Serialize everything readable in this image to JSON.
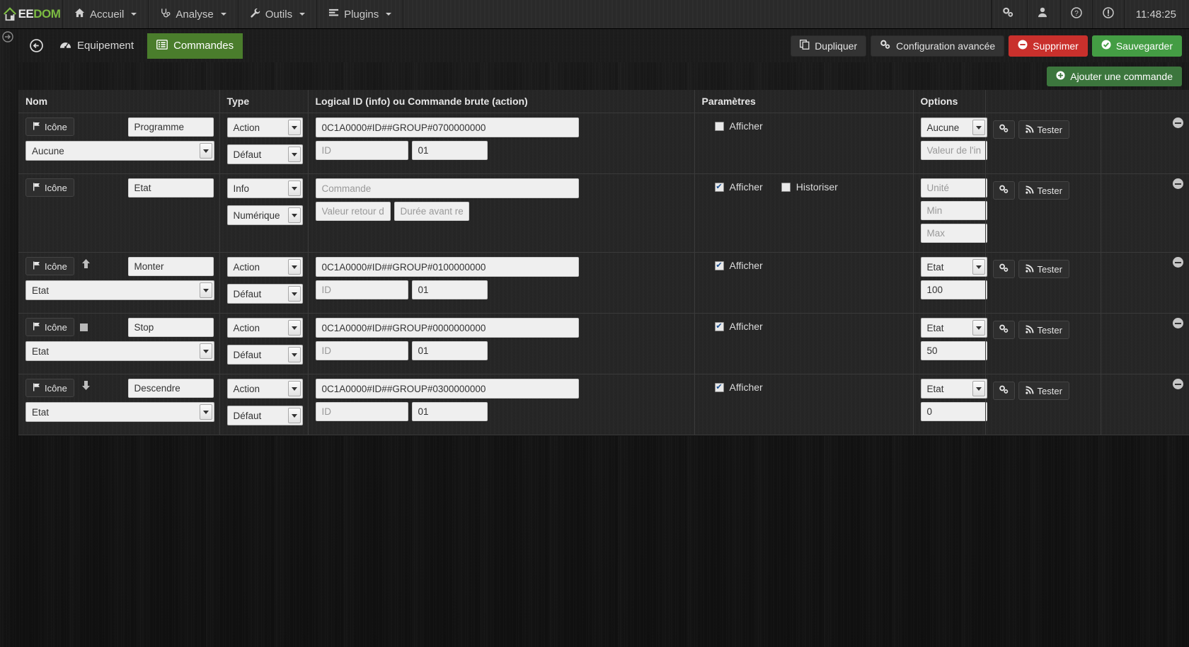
{
  "navbar": {
    "brand": {
      "ee": "EE",
      "dom": "DOM"
    },
    "menus": [
      {
        "label": "Accueil",
        "icon": "home-icon"
      },
      {
        "label": "Analyse",
        "icon": "stethoscope-icon"
      },
      {
        "label": "Outils",
        "icon": "wrench-icon"
      },
      {
        "label": "Plugins",
        "icon": "list-icon"
      }
    ],
    "right_icons": [
      {
        "name": "gears-icon",
        "caret": true
      },
      {
        "name": "user-icon",
        "caret": true
      },
      {
        "name": "help-icon",
        "caret": false
      },
      {
        "name": "warning-icon",
        "caret": false
      }
    ],
    "clock": "11:48:25"
  },
  "toolbar": {
    "back_icon": "arrow-left-circle-icon",
    "tabs": [
      {
        "label": "Equipement",
        "icon": "dashboard-icon",
        "active": false
      },
      {
        "label": "Commandes",
        "icon": "list-alt-icon",
        "active": true
      }
    ],
    "buttons": [
      {
        "label": "Dupliquer",
        "icon": "copy-icon",
        "style": "dark"
      },
      {
        "label": "Configuration avancée",
        "icon": "gears-icon",
        "style": "dark"
      },
      {
        "label": "Supprimer",
        "icon": "minus-circle-icon",
        "style": "danger"
      },
      {
        "label": "Sauvegarder",
        "icon": "check-circle-icon",
        "style": "success"
      }
    ],
    "add_command": {
      "label": "Ajouter une commande",
      "icon": "plus-circle-icon"
    }
  },
  "table": {
    "headers": {
      "nom": "Nom",
      "type": "Type",
      "logical": "Logical ID (info) ou Commande brute (action)",
      "params": "Paramètres",
      "options": "Options",
      "actions": "",
      "delete": ""
    },
    "labels": {
      "icone": "Icône",
      "afficher": "Afficher",
      "historiser": "Historiser",
      "tester": "Tester"
    },
    "rows": [
      {
        "indicator": "none",
        "name": "Programme",
        "subselect": "Aucune",
        "type": "Action",
        "subtype": "Défaut",
        "logical": "0C1A0000#ID##GROUP#0700000000",
        "id_placeholder": "ID",
        "id_value": "",
        "sub_value": "01",
        "afficher": false,
        "show_historiser": false,
        "historiser": false,
        "opt_select": "Aucune",
        "opt_fields": [
          {
            "placeholder": "Valeur de l'info",
            "value": ""
          }
        ]
      },
      {
        "indicator": "none",
        "name": "Etat",
        "subselect": null,
        "type": "Info",
        "subtype": "Numérique",
        "logical": "",
        "logical_placeholder": "Commande",
        "info_fields": [
          {
            "placeholder": "Valeur retour d'état",
            "value": ""
          },
          {
            "placeholder": "Durée avant retour",
            "value": ""
          }
        ],
        "afficher": true,
        "show_historiser": true,
        "historiser": false,
        "opt_select": null,
        "opt_fields": [
          {
            "placeholder": "Unité",
            "value": ""
          },
          {
            "placeholder": "Min",
            "value": ""
          },
          {
            "placeholder": "Max",
            "value": ""
          }
        ]
      },
      {
        "indicator": "arrow-up",
        "name": "Monter",
        "subselect": "Etat",
        "type": "Action",
        "subtype": "Défaut",
        "logical": "0C1A0000#ID##GROUP#0100000000",
        "id_placeholder": "ID",
        "id_value": "",
        "sub_value": "01",
        "afficher": true,
        "show_historiser": false,
        "historiser": false,
        "opt_select": "Etat",
        "opt_fields": [
          {
            "placeholder": "",
            "value": "100"
          }
        ]
      },
      {
        "indicator": "square",
        "name": "Stop",
        "subselect": "Etat",
        "type": "Action",
        "subtype": "Défaut",
        "logical": "0C1A0000#ID##GROUP#0000000000",
        "id_placeholder": "ID",
        "id_value": "",
        "sub_value": "01",
        "afficher": true,
        "show_historiser": false,
        "historiser": false,
        "opt_select": "Etat",
        "opt_fields": [
          {
            "placeholder": "",
            "value": "50"
          }
        ]
      },
      {
        "indicator": "arrow-down",
        "name": "Descendre",
        "subselect": "Etat",
        "type": "Action",
        "subtype": "Défaut",
        "logical": "0C1A0000#ID##GROUP#0300000000",
        "id_placeholder": "ID",
        "id_value": "",
        "sub_value": "01",
        "afficher": true,
        "show_historiser": false,
        "historiser": false,
        "opt_select": "Etat",
        "opt_fields": [
          {
            "placeholder": "",
            "value": "0"
          }
        ]
      }
    ]
  },
  "colors": {
    "brand_green": "#7cbb42",
    "tab_active": "#4a7d2c",
    "danger": "#c9302c",
    "success": "#449d44",
    "navbar_bg": "#2b2b2b"
  }
}
